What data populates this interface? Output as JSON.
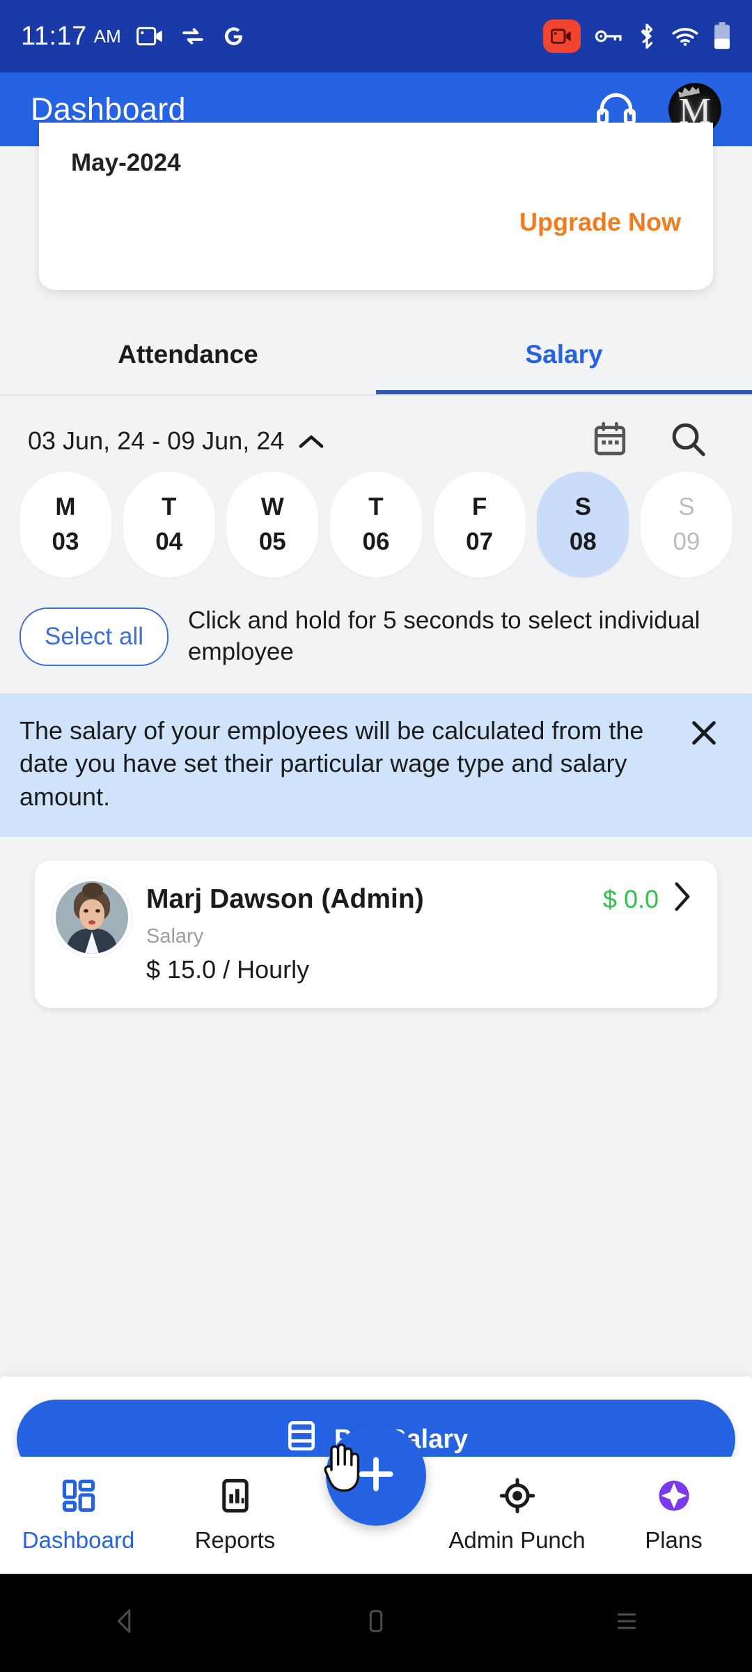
{
  "status_bar": {
    "time": "11:17",
    "ampm": "AM",
    "icons_left": [
      "screen-record-icon",
      "data-saver-icon",
      "google-icon"
    ],
    "icons_right": [
      "recording-badge-icon",
      "vpn-key-icon",
      "bluetooth-icon",
      "wifi-icon",
      "battery-icon"
    ],
    "background": "#1a3aa8"
  },
  "app_bar": {
    "title": "Dashboard",
    "headset_icon": "headset-support-icon",
    "avatar_letter": "M",
    "background": "#2563e3"
  },
  "upgrade_card": {
    "month": "May-2024",
    "upgrade_label": "Upgrade Now",
    "upgrade_color": "#f07c20"
  },
  "tabs": {
    "items": [
      {
        "label": "Attendance",
        "active": false
      },
      {
        "label": "Salary",
        "active": true
      }
    ],
    "active_color": "#2563e3",
    "underline_color": "#2f56b5"
  },
  "date_selector": {
    "range_label": "03 Jun, 24 - 09 Jun, 24",
    "chevron": "chevron-up-icon",
    "calendar_icon": "calendar-icon",
    "search_icon": "search-icon",
    "days": [
      {
        "dow": "M",
        "num": "03",
        "state": "normal"
      },
      {
        "dow": "T",
        "num": "04",
        "state": "normal"
      },
      {
        "dow": "W",
        "num": "05",
        "state": "normal"
      },
      {
        "dow": "T",
        "num": "06",
        "state": "normal"
      },
      {
        "dow": "F",
        "num": "07",
        "state": "normal"
      },
      {
        "dow": "S",
        "num": "08",
        "state": "selected"
      },
      {
        "dow": "S",
        "num": "09",
        "state": "disabled"
      }
    ],
    "selected_bg": "#c9ddfb"
  },
  "select_row": {
    "select_all_label": "Select all",
    "hint": "Click and hold for 5 seconds to select individual employee"
  },
  "banner": {
    "text": "The salary of your employees will be calculated from the date you have set their particular wage type and salary amount.",
    "close_icon": "close-icon",
    "background": "#cfe3fa"
  },
  "employees": [
    {
      "name": "Marj Dawson (Admin)",
      "amount": "$ 0.0",
      "amount_color": "#2ec24e",
      "salary_label": "Salary",
      "wage": "$ 15.0 / Hourly",
      "chevron": "chevron-right-icon"
    }
  ],
  "pay_button": {
    "label": "Pay Salary",
    "icon": "payment-card-icon",
    "background": "#2563e3"
  },
  "fab": {
    "icon": "plus-icon",
    "background": "#2563e3"
  },
  "cursor": {
    "icon": "pointing-hand-cursor"
  },
  "bottom_nav": {
    "items": [
      {
        "label": "Dashboard",
        "icon": "dashboard-grid-icon",
        "active": true
      },
      {
        "label": "Reports",
        "icon": "reports-chart-icon",
        "active": false
      },
      {
        "label": "Admin Punch",
        "icon": "location-target-icon",
        "active": false
      },
      {
        "label": "Plans",
        "icon": "plans-sparkle-icon",
        "active": false
      }
    ],
    "active_color": "#2563e3",
    "plans_icon_color": "#7c3aed"
  },
  "android_nav": {
    "back": "back-triangle-icon",
    "home": "home-square-icon",
    "recents": "recents-menu-icon"
  }
}
